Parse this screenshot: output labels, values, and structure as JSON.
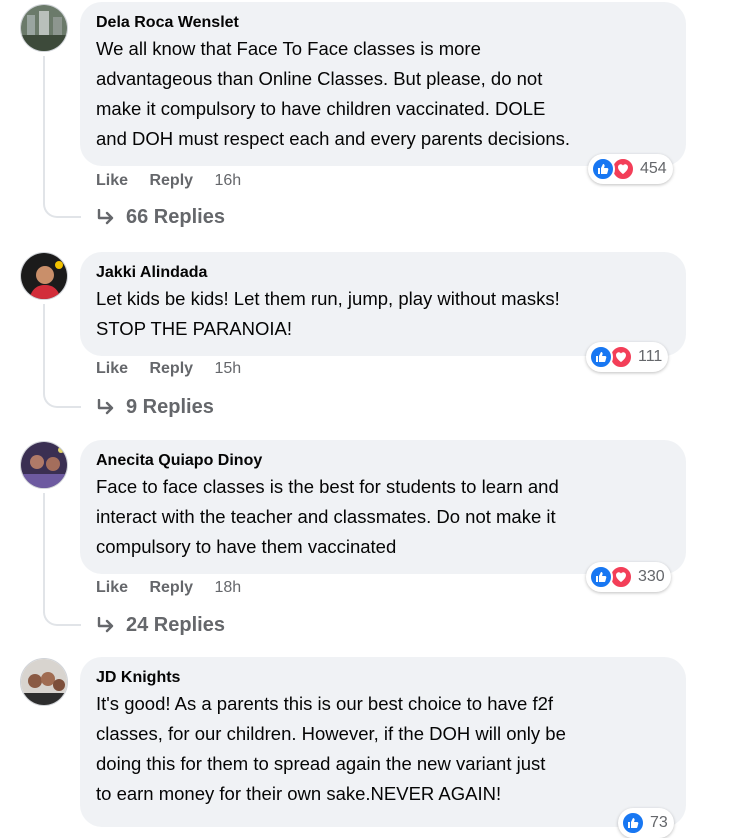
{
  "comments": [
    {
      "author": "Dela Roca Wenslet",
      "lines": [
        "We all know that Face To Face classes is more",
        "advantageous than Online Classes. But please, do not",
        "make it compulsory to have children vaccinated. DOLE",
        "and DOH must respect each and every parents decisions."
      ],
      "like_label": "Like",
      "reply_label": "Reply",
      "time": "16h",
      "reaction_count": "454",
      "replies_label": "66 Replies"
    },
    {
      "author": "Jakki Alindada",
      "lines": [
        "Let kids be kids! Let them run, jump, play without masks!",
        "STOP THE PARANOIA!"
      ],
      "like_label": "Like",
      "reply_label": "Reply",
      "time": "15h",
      "reaction_count": "111",
      "replies_label": "9 Replies"
    },
    {
      "author": "Anecita Quiapo Dinoy",
      "lines": [
        "Face to face classes is the best for students to learn and",
        "interact with the teacher and classmates. Do not make it",
        "compulsory to have them vaccinated"
      ],
      "like_label": "Like",
      "reply_label": "Reply",
      "time": "18h",
      "reaction_count": "330",
      "replies_label": "24 Replies"
    },
    {
      "author": "JD Knights",
      "lines": [
        "It's good! As a parents this is our best choice to have f2f",
        "classes, for our children. However, if the DOH will only be",
        "doing this for them to spread again the new variant just",
        "to earn money for their own sake.NEVER AGAIN!"
      ],
      "reaction_count": "73"
    }
  ],
  "colors": {
    "bubble": "#f0f2f5",
    "like_blue": "#1877f2",
    "love_red": "#f33e58",
    "secondary_text": "#65676b"
  }
}
